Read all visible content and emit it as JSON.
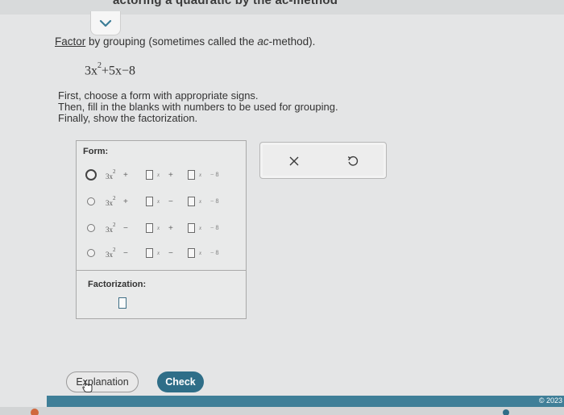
{
  "header": {
    "title_fragment": "actoring a quadratic by the ac-method"
  },
  "problem": {
    "link_word": "Factor",
    "rest_before_em": " by grouping (sometimes called the ",
    "em": "ac",
    "rest_after_em": "-method).",
    "expr_a": "3x",
    "expr_exp": "2",
    "expr_rest": "+5x−8"
  },
  "instructions": [
    "First, choose a form with appropriate signs.",
    "Then, fill in the blanks with numbers to be used for grouping.",
    "Finally, show the factorization."
  ],
  "form": {
    "label": "Form:",
    "options": [
      {
        "lead": "3x",
        "exp": "2",
        "s1": "+",
        "x1": "x",
        "s2": "+",
        "x2": "x",
        "tail": "− 8"
      },
      {
        "lead": "3x",
        "exp": "2",
        "s1": "+",
        "x1": "x",
        "s2": "−",
        "x2": "x",
        "tail": "− 8"
      },
      {
        "lead": "3x",
        "exp": "2",
        "s1": "−",
        "x1": "x",
        "s2": "+",
        "x2": "x",
        "tail": "− 8"
      },
      {
        "lead": "3x",
        "exp": "2",
        "s1": "−",
        "x1": "x",
        "s2": "−",
        "x2": "x",
        "tail": "− 8"
      }
    ],
    "selected_index": 0
  },
  "factorization": {
    "label": "Factorization:"
  },
  "actions": {
    "clear_icon": "x-icon",
    "undo_icon": "undo-icon"
  },
  "buttons": {
    "explanation": "Explanation",
    "check": "Check"
  },
  "footer": {
    "copyright": "© 2023 "
  },
  "colors": {
    "accent": "#2f6e88",
    "bar": "#3f7f98",
    "background": "#e4e5e6"
  }
}
